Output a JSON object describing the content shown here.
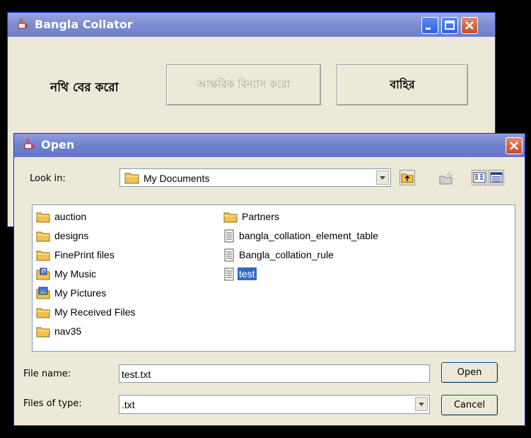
{
  "main_window": {
    "title": "Bangla Collator",
    "label": "নথি বের করো",
    "sort_button": "আক্ষরিক বিন্যাস করো",
    "exit_button": "বাহির"
  },
  "dialog": {
    "title": "Open",
    "look_in_label": "Look in:",
    "look_in_value": "My Documents",
    "files": [
      {
        "name": "auction",
        "icon": "folder-icon"
      },
      {
        "name": "designs",
        "icon": "folder-icon"
      },
      {
        "name": "FinePrint files",
        "icon": "folder-icon"
      },
      {
        "name": "My Music",
        "icon": "music-folder-icon"
      },
      {
        "name": "My Pictures",
        "icon": "pictures-folder-icon"
      },
      {
        "name": "My Received Files",
        "icon": "folder-icon"
      },
      {
        "name": "nav35",
        "icon": "folder-icon"
      },
      {
        "name": "Partners",
        "icon": "folder-icon"
      },
      {
        "name": "bangla_collation_element_table",
        "icon": "file-icon"
      },
      {
        "name": "Bangla_collation_rule",
        "icon": "file-icon"
      },
      {
        "name": "test",
        "icon": "file-icon",
        "selected": true
      }
    ],
    "file_name_label": "File name:",
    "file_name_value": "test.txt",
    "file_type_label": "Files of type:",
    "file_type_value": ".txt",
    "open_button": "Open",
    "cancel_button": "Cancel"
  }
}
